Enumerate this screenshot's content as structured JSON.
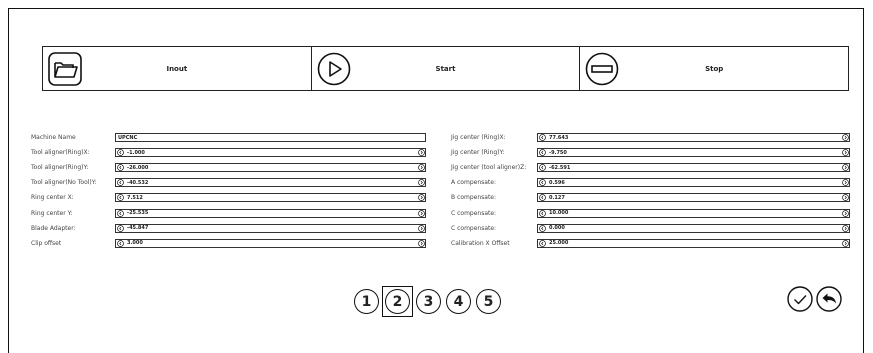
{
  "toolbar": {
    "input_label": "Inout",
    "start_label": "Start",
    "stop_label": "Stop"
  },
  "left_fields": [
    {
      "label": "Machine Name",
      "value": "UPCNC"
    },
    {
      "label": "Tool aligner(Ring)X:",
      "value": "-1.000"
    },
    {
      "label": "Tool aligner(Ring)Y:",
      "value": "-26.000"
    },
    {
      "label": "Tool aligner(No Tool)Y:",
      "value": "-40.532"
    },
    {
      "label": "Ring center X:",
      "value": "7.512"
    },
    {
      "label": "Ring center Y:",
      "value": "-25.535"
    },
    {
      "label": "Blade Adapter:",
      "value": "-45.847"
    },
    {
      "label": "Clip offset",
      "value": "3.000"
    }
  ],
  "right_fields": [
    {
      "label": "Jig center (Ring)X:",
      "value": "77.643"
    },
    {
      "label": "Jig center (Ring)Y:",
      "value": "-9.750"
    },
    {
      "label": "Jig center (tool aligner)Z:",
      "value": "-62.591"
    },
    {
      "label": "A compensate:",
      "value": "0.596"
    },
    {
      "label": "B compensate:",
      "value": "0.127"
    },
    {
      "label": "C compensate:",
      "value": "10.000"
    },
    {
      "label": "C compensate:",
      "value": "0.000"
    },
    {
      "label": "Calibration X Offset",
      "value": "25.000"
    }
  ],
  "pagination": {
    "pages": [
      "1",
      "2",
      "3",
      "4",
      "5"
    ],
    "current": "2"
  }
}
